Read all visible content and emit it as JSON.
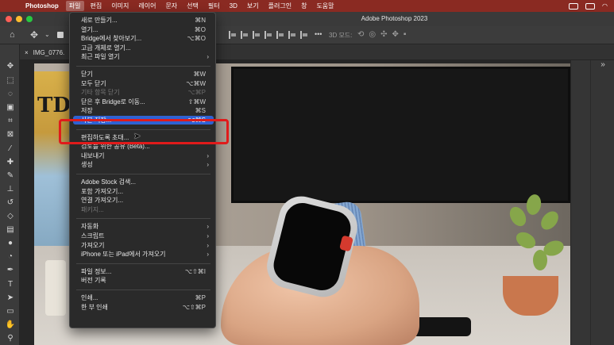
{
  "menubar": {
    "app_name": "Photoshop",
    "items": [
      "파일",
      "편집",
      "이미지",
      "레이어",
      "문자",
      "선택",
      "필터",
      "3D",
      "보기",
      "플러그인",
      "창",
      "도움말"
    ],
    "active_index": 0
  },
  "window": {
    "title": "Adobe Photoshop 2023"
  },
  "options_bar": {
    "label_3d": "3D 모드:"
  },
  "document": {
    "tab_label": "IMG_0776."
  },
  "file_menu": {
    "items": [
      {
        "label": "새로 만들기...",
        "shortcut": "⌘N",
        "type": "item"
      },
      {
        "label": "열기...",
        "shortcut": "⌘O",
        "type": "item"
      },
      {
        "label": "Bridge에서 찾아보기...",
        "shortcut": "⌥⌘O",
        "type": "item"
      },
      {
        "label": "고급 개체로 열기...",
        "shortcut": "",
        "type": "item"
      },
      {
        "label": "최근 파일 열기",
        "shortcut": "",
        "type": "submenu"
      },
      {
        "type": "separator"
      },
      {
        "label": "닫기",
        "shortcut": "⌘W",
        "type": "item"
      },
      {
        "label": "모두 닫기",
        "shortcut": "⌥⌘W",
        "type": "item"
      },
      {
        "label": "기타 항목 닫기",
        "shortcut": "⌥⌘P",
        "type": "disabled"
      },
      {
        "label": "닫은 후 Bridge로 이동...",
        "shortcut": "⇧⌘W",
        "type": "item"
      },
      {
        "label": "저장",
        "shortcut": "⌘S",
        "type": "item"
      },
      {
        "label": "사본 저장...",
        "shortcut": "⌥⌘S",
        "type": "highlight"
      },
      {
        "type": "separator"
      },
      {
        "label": "편집하도록 초대...",
        "shortcut": "",
        "type": "item"
      },
      {
        "label": "검토를 위한 공유 (Beta)...",
        "shortcut": "",
        "type": "item"
      },
      {
        "label": "내보내기",
        "shortcut": "",
        "type": "submenu"
      },
      {
        "label": "생성",
        "shortcut": "",
        "type": "submenu"
      },
      {
        "type": "separator"
      },
      {
        "label": "Adobe Stock 검색...",
        "shortcut": "",
        "type": "item"
      },
      {
        "label": "포함 가져오기...",
        "shortcut": "",
        "type": "item"
      },
      {
        "label": "연결 가져오기...",
        "shortcut": "",
        "type": "item"
      },
      {
        "label": "패키지...",
        "shortcut": "",
        "type": "disabled"
      },
      {
        "type": "separator"
      },
      {
        "label": "자동화",
        "shortcut": "",
        "type": "submenu"
      },
      {
        "label": "스크립트",
        "shortcut": "",
        "type": "submenu"
      },
      {
        "label": "가져오기",
        "shortcut": "",
        "type": "submenu"
      },
      {
        "label": "iPhone 또는 iPad에서 가져오기",
        "shortcut": "",
        "type": "submenu"
      },
      {
        "type": "separator"
      },
      {
        "label": "파일 정보...",
        "shortcut": "⌥⇧⌘I",
        "type": "item"
      },
      {
        "label": "버전 기록",
        "shortcut": "",
        "type": "item"
      },
      {
        "type": "separator"
      },
      {
        "label": "인쇄...",
        "shortcut": "⌘P",
        "type": "item"
      },
      {
        "label": "한 부 인쇄",
        "shortcut": "⌥⇧⌘P",
        "type": "item"
      }
    ]
  },
  "icons": {
    "apple": "apple-icon",
    "home": "home-icon",
    "move": "move-tool-icon",
    "wifi": "wifi-icon",
    "cursor": "pointer-cursor-icon"
  }
}
